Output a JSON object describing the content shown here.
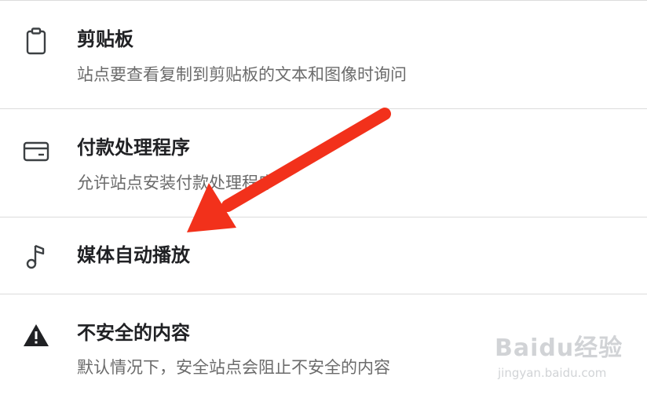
{
  "settings": {
    "items": [
      {
        "icon": "clipboard-icon",
        "title": "剪贴板",
        "subtitle": "站点要查看复制到剪贴板的文本和图像时询问"
      },
      {
        "icon": "credit-card-icon",
        "title": "付款处理程序",
        "subtitle": "允许站点安装付款处理程序"
      },
      {
        "icon": "music-note-icon",
        "title": "媒体自动播放",
        "subtitle": ""
      },
      {
        "icon": "warning-icon",
        "title": "不安全的内容",
        "subtitle": "默认情况下，安全站点会阻止不安全的内容"
      }
    ]
  },
  "annotation": {
    "color": "#f2311b"
  },
  "watermark": {
    "logo_text": "Baidu经验",
    "url": "jingyan.baidu.com"
  }
}
